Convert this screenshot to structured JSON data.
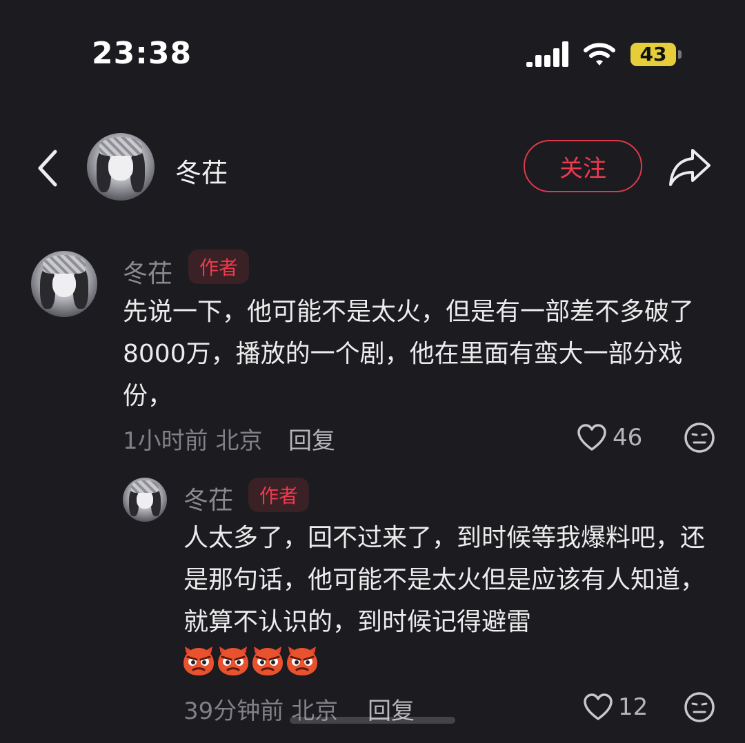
{
  "status_bar": {
    "time": "23:38",
    "battery": "43"
  },
  "header": {
    "username": "冬茌",
    "follow_label": "关注"
  },
  "comments": [
    {
      "username": "冬茌",
      "badge": "作者",
      "text": "先说一下，他可能不是太火，但是有一部差不多破了8000万，播放的一个剧，他在里面有蛮大一部分戏份，",
      "meta": "1小时前 北京",
      "reply_label": "回复",
      "likes": "46"
    }
  ],
  "replies": [
    {
      "username": "冬茌",
      "badge": "作者",
      "text": "人太多了，回不过来了，到时候等我爆料吧，还是那句话，他可能不是太火但是应该有人知道，就算不认识的，到时候记得避雷",
      "emojis": [
        "devil-emoji",
        "devil-emoji",
        "devil-emoji",
        "devil-emoji"
      ],
      "meta": "39分钟前 北京",
      "reply_label": "回复",
      "likes": "12"
    }
  ],
  "colors": {
    "accent": "#f0394e",
    "background": "#1b1b20",
    "battery": "#e6ce3a"
  }
}
